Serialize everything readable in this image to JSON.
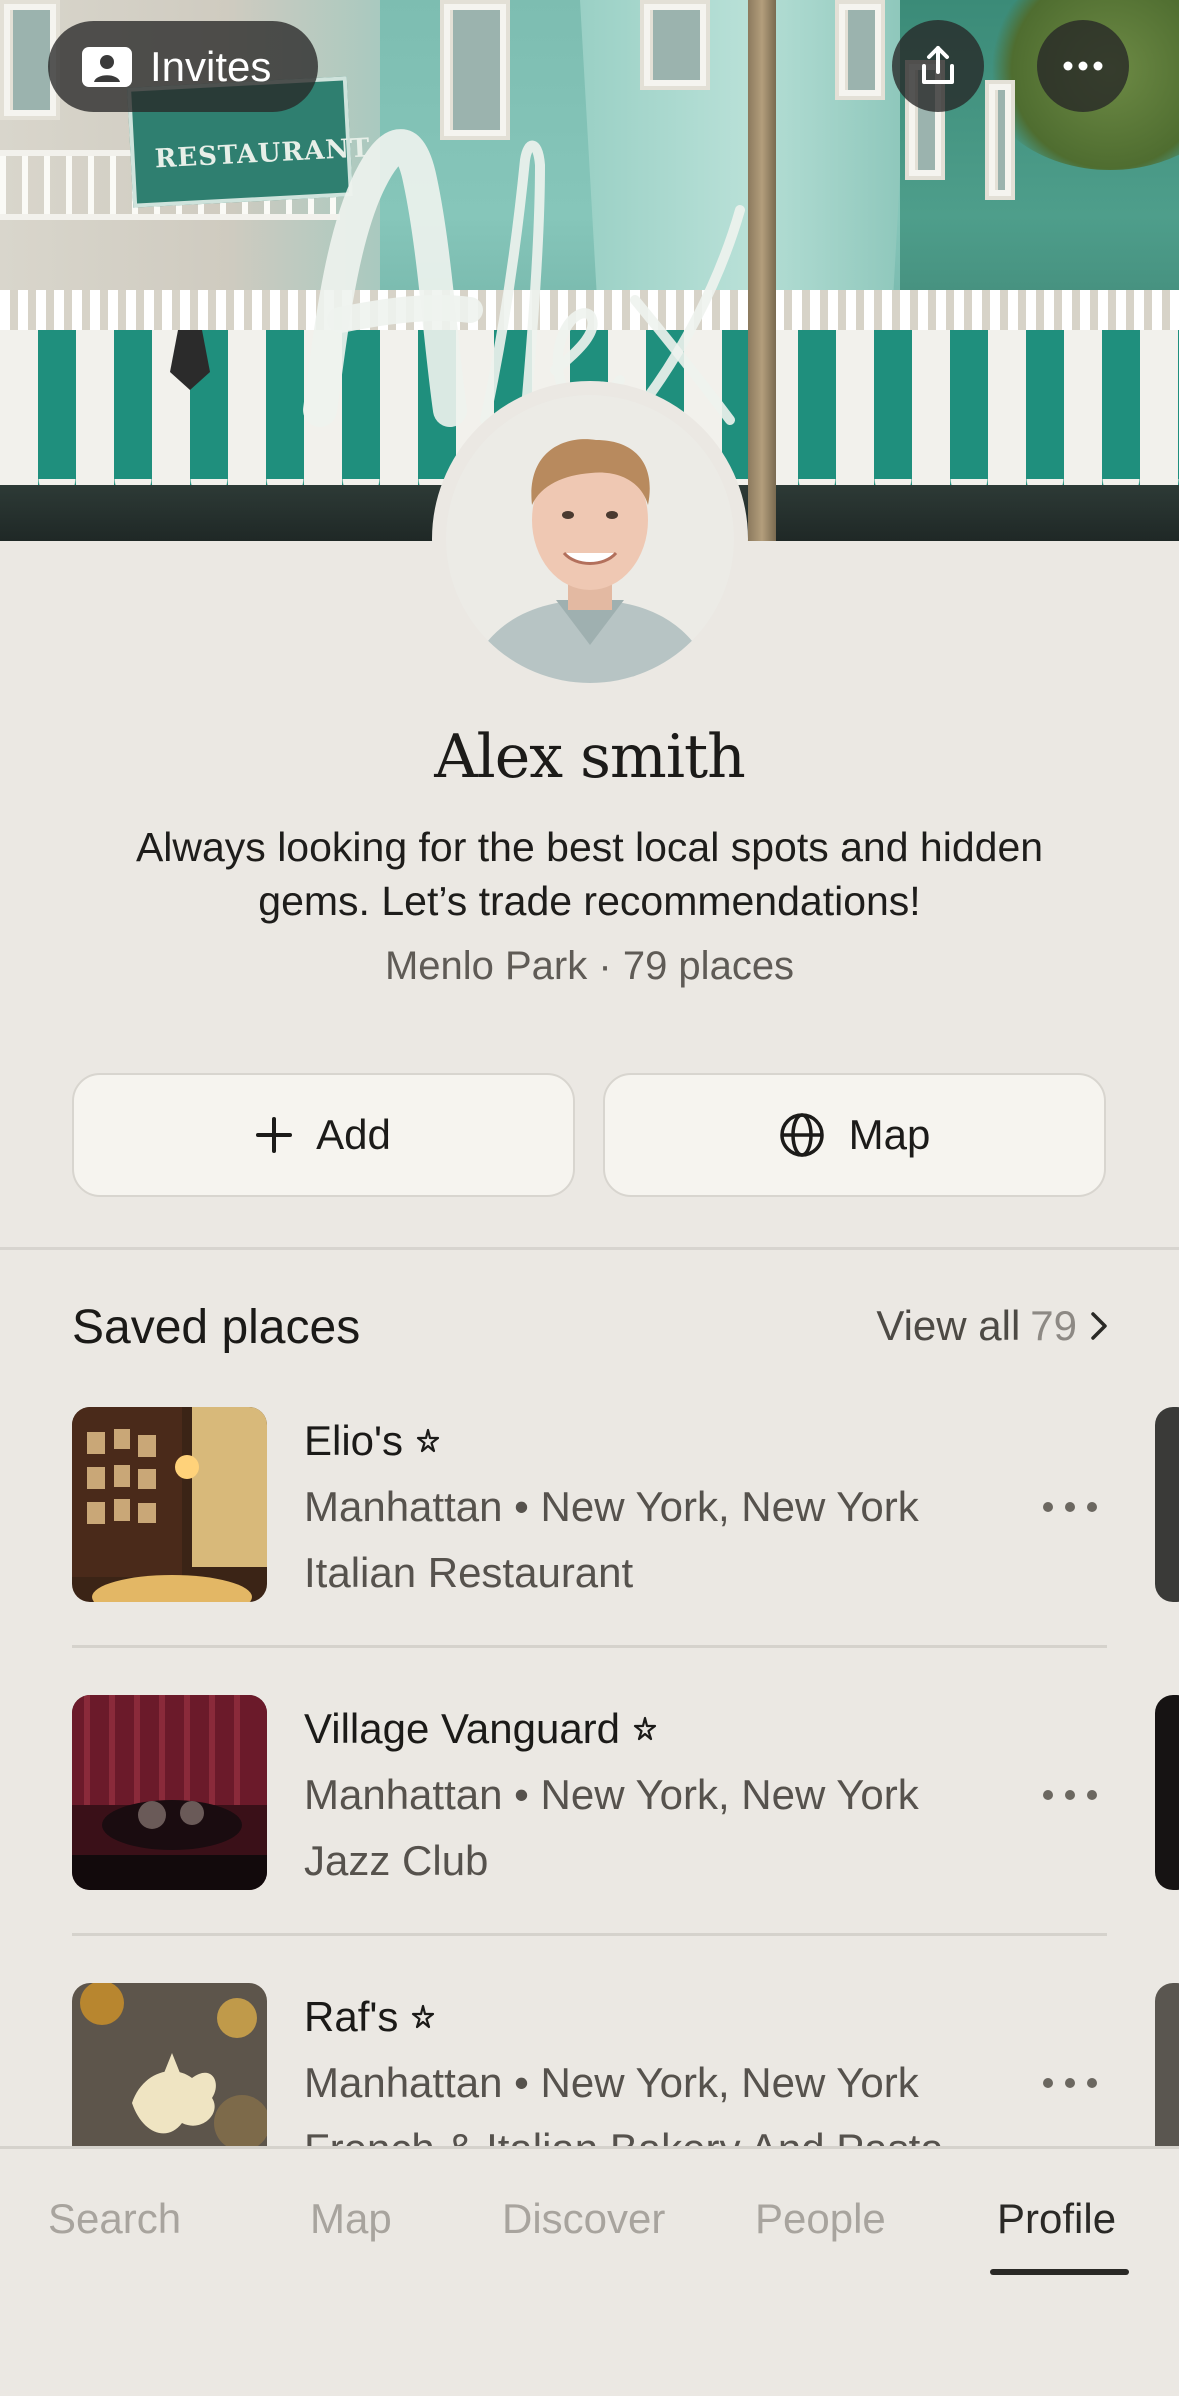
{
  "header": {
    "invites_label": "Invites",
    "signature_text": "Alex"
  },
  "profile": {
    "name": "Alex smith",
    "bio": "Always looking for the best local spots and hidden gems. Let’s trade recommendations!",
    "location": "Menlo Park",
    "separator": "·",
    "places_count": "79 places"
  },
  "actions": {
    "add_label": "Add",
    "map_label": "Map"
  },
  "saved": {
    "title": "Saved places",
    "view_all_label": "View all",
    "view_all_count": "79",
    "items": [
      {
        "name": "Elio's",
        "location": "Manhattan • New York, New York",
        "category": "Italian Restaurant"
      },
      {
        "name": "Village Vanguard",
        "location": "Manhattan • New York, New York",
        "category": "Jazz Club"
      },
      {
        "name": "Raf's",
        "location": "Manhattan • New York, New York",
        "category": "French & Italian Bakery And Pasta"
      }
    ]
  },
  "nav": {
    "items": [
      "Search",
      "Map",
      "Discover",
      "People",
      "Profile"
    ],
    "active": "Profile"
  },
  "colors": {
    "background": "#ebe8e3",
    "button_bg": "#f6f4ef",
    "text_primary": "#1c1b19",
    "text_secondary": "#56524d",
    "nav_inactive": "#a8a49e"
  }
}
